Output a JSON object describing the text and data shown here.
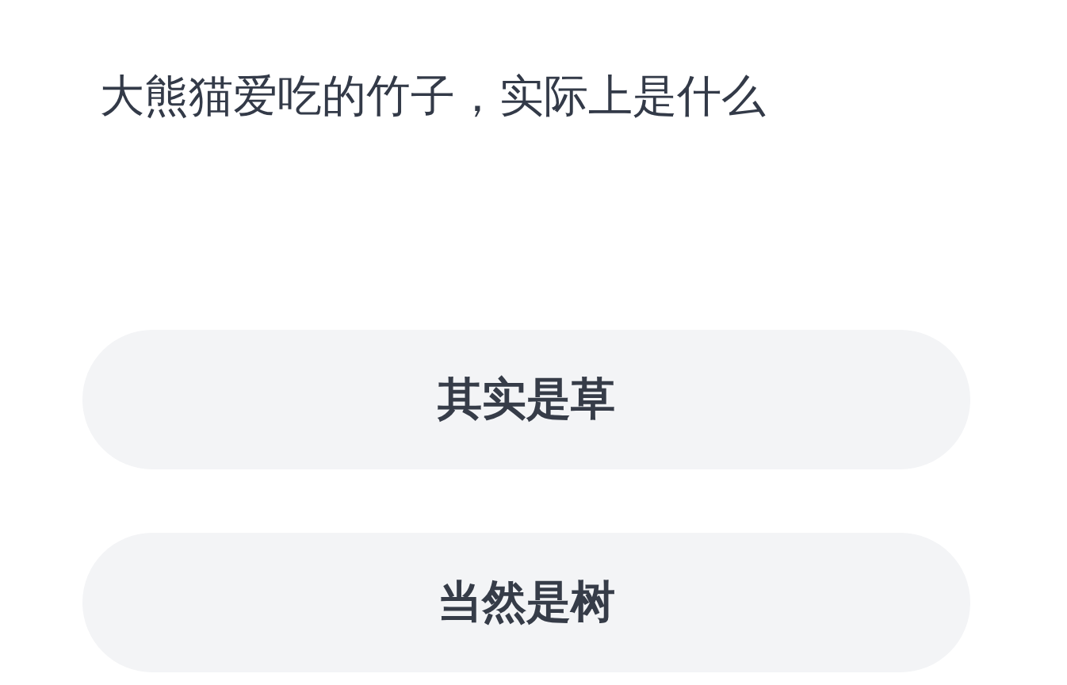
{
  "question": "大熊猫爱吃的竹子，实际上是什么",
  "options": [
    {
      "label": "其实是草"
    },
    {
      "label": "当然是树"
    }
  ]
}
